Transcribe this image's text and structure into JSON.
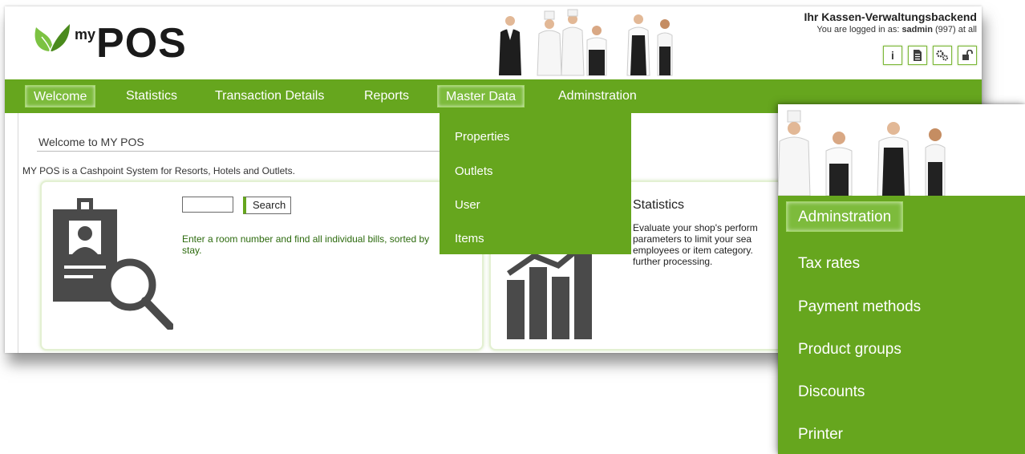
{
  "header": {
    "logo_sup": "my",
    "logo_main": "POS",
    "title": "Ihr Kassen-Verwaltungsbackend",
    "login_prefix": "You are logged in as:",
    "login_user": "sadmin",
    "login_suffix": "(997) at all",
    "icons": [
      "info-icon",
      "document-icon",
      "settings-icon",
      "unlock-icon"
    ]
  },
  "nav": {
    "items": [
      "Welcome",
      "Statistics",
      "Transaction Details",
      "Reports",
      "Master Data",
      "Adminstration"
    ],
    "active": "Welcome",
    "highlighted": "Master Data"
  },
  "master_data_menu": [
    "Properties",
    "Outlets",
    "User",
    "Items"
  ],
  "content": {
    "welcome_title": "Welcome to MY POS",
    "welcome_desc": "MY POS is a Cashpoint System for Resorts, Hotels and Outlets.",
    "search": {
      "button": "Search",
      "value": "",
      "text": "Enter a room number and find all individual bills, sorted by stay."
    },
    "stats": {
      "title": "Statistics",
      "lines": [
        "Evaluate your shop's perform",
        "parameters to limit your sea",
        "employees or item category.",
        "further processing."
      ]
    }
  },
  "admin_menu": {
    "items": [
      "Adminstration",
      "Tax rates",
      "Payment methods",
      "Product groups",
      "Discounts",
      "Printer"
    ],
    "active": "Adminstration"
  },
  "colors": {
    "brand_green": "#66a61e",
    "active_green": "#7dbb3c",
    "icon_dark": "#4a4a4a"
  }
}
